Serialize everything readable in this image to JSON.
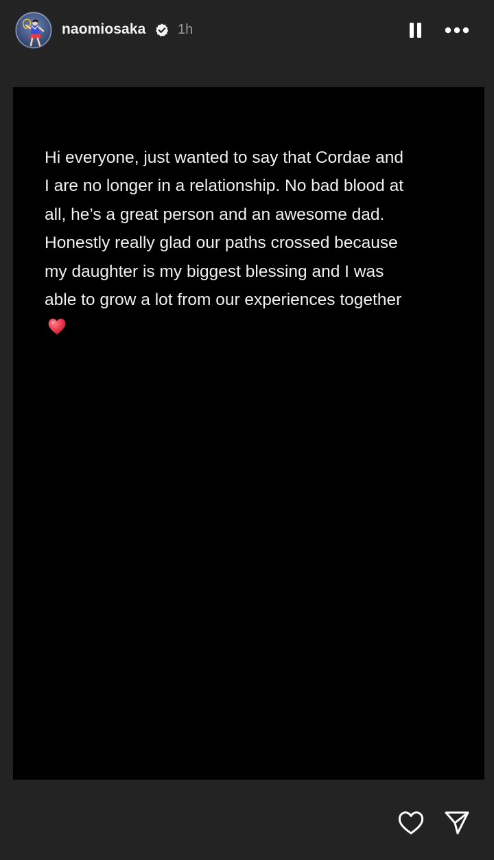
{
  "header": {
    "username": "naomiosaka",
    "time_ago": "1h"
  },
  "story": {
    "text": "Hi everyone, just wanted to say that Cordae and\nI are no longer in a relationship. No bad blood at\nall, he’s a great person and an awesome dad.\nHonestly really glad our paths crossed because\nmy daughter is my biggest blessing and I was\nable to grow a lot from our experiences together",
    "emoji": "red-heart"
  },
  "icons": {
    "verified": "verified-badge-icon",
    "pause": "pause-icon",
    "more": "more-options-icon",
    "like": "heart-outline-icon",
    "share": "send-icon"
  },
  "colors": {
    "background": "#232323",
    "story_background": "#000000",
    "text": "#f0f0f0",
    "muted": "#9a9a9a",
    "heart": "#e8384f"
  }
}
